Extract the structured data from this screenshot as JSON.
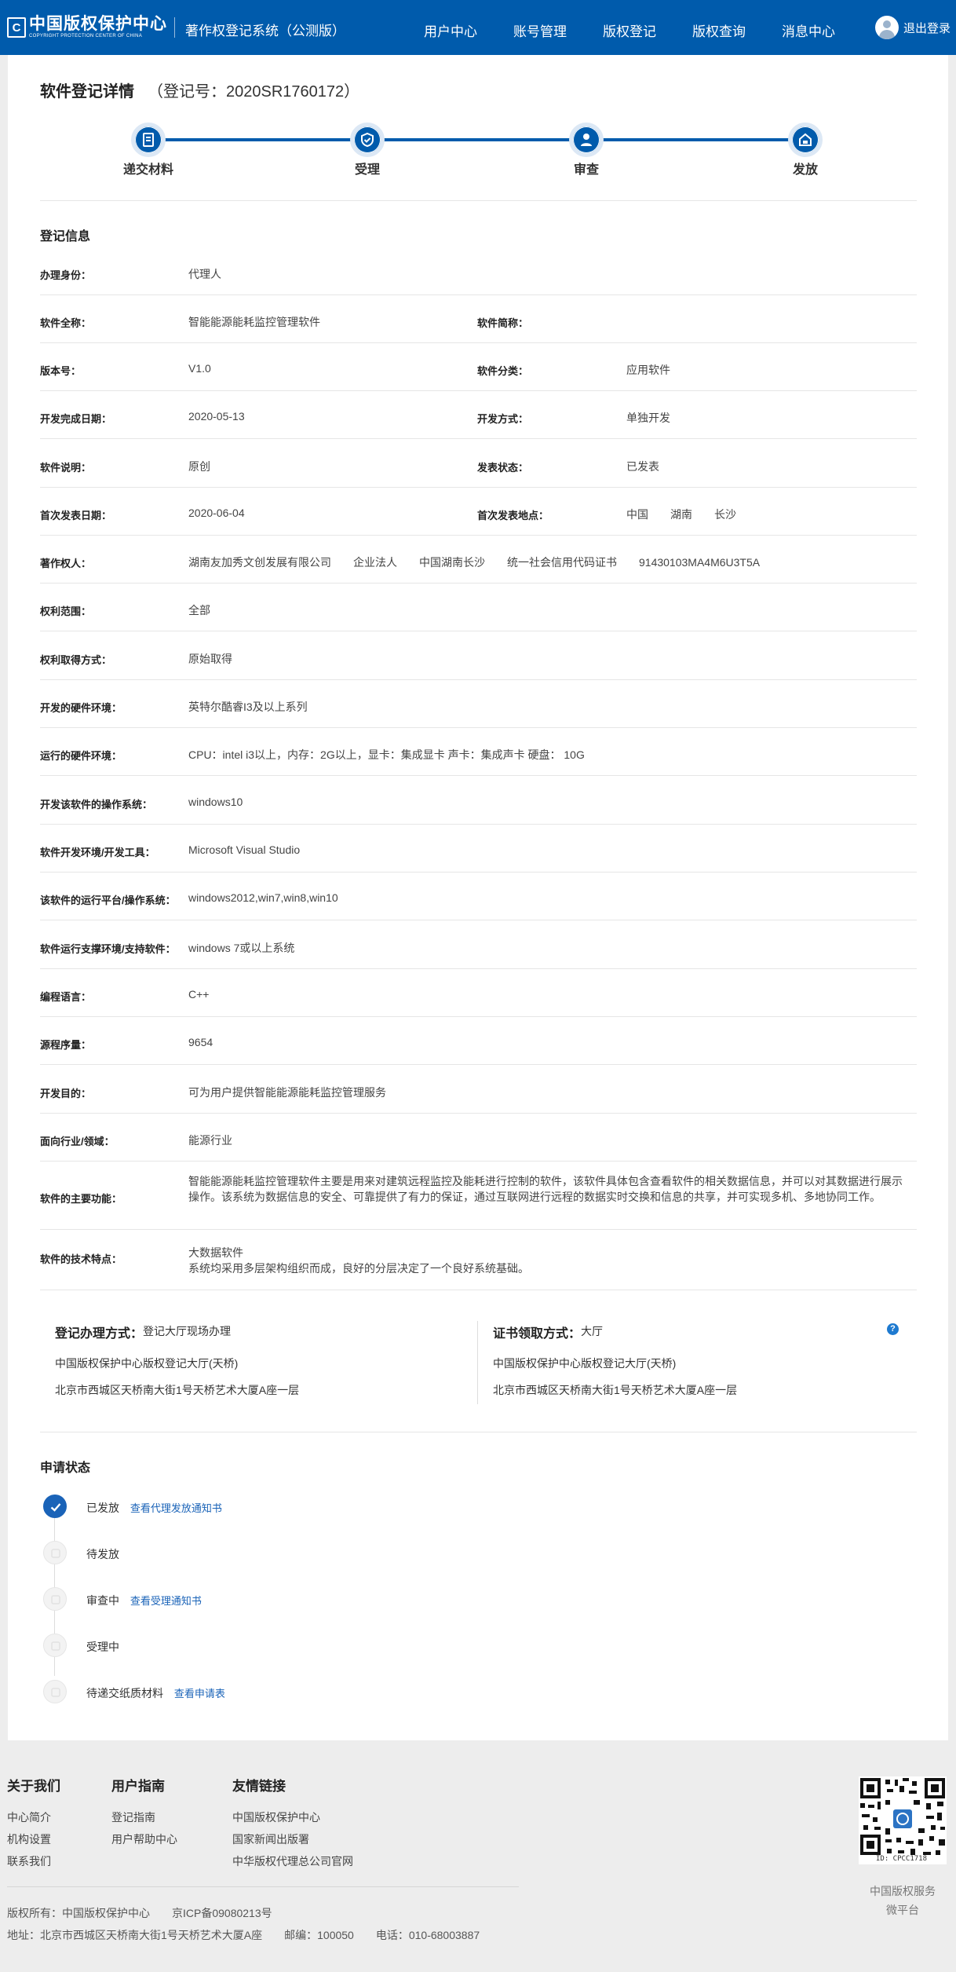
{
  "header": {
    "logo_mark": "C",
    "logo_cn": "中国版权保护中心",
    "logo_en": "COPYRIGHT PROTECTION CENTER OF CHINA",
    "system_title": "著作权登记系统（公测版）",
    "nav": [
      "用户中心",
      "账号管理",
      "版权登记",
      "版权查询",
      "消息中心"
    ],
    "logout": "退出登录",
    "accent_color": "#005bac"
  },
  "detail": {
    "title": "软件登记详情",
    "reg_no": "（登记号：2020SR1760172）"
  },
  "steps": [
    "递交材料",
    "受理",
    "审查",
    "发放"
  ],
  "info": {
    "section_title": "登记信息",
    "rows": [
      {
        "label": "办理身份：",
        "value": "代理人"
      },
      {
        "label": "软件全称：",
        "value": "智能能源能耗监控管理软件",
        "label2": "软件简称：",
        "value2": ""
      },
      {
        "label": "版本号：",
        "value": "V1.0",
        "label2": "软件分类：",
        "value2": "应用软件"
      },
      {
        "label": "开发完成日期：",
        "value": "2020-05-13",
        "label2": "开发方式：",
        "value2": "单独开发"
      },
      {
        "label": "软件说明：",
        "value": "原创",
        "label2": "发表状态：",
        "value2": "已发表"
      },
      {
        "label": "首次发表日期：",
        "value": "2020-06-04",
        "label2": "首次发表地点：",
        "value2": "中国　　湖南　　长沙"
      },
      {
        "label": "著作权人：",
        "value": "湖南友加秀文创发展有限公司　　企业法人　　中国湖南长沙　　统一社会信用代码证书　　91430103MA4M6U3T5A"
      },
      {
        "label": "权利范围：",
        "value": "全部"
      },
      {
        "label": "权利取得方式：",
        "value": "原始取得"
      },
      {
        "label": "开发的硬件环境：",
        "value": "英特尔酷睿I3及以上系列"
      },
      {
        "label": "运行的硬件环境：",
        "value": "CPU：intel i3以上，内存：2G以上，显卡：集成显卡 声卡：集成声卡 硬盘：  10G"
      },
      {
        "label": "开发该软件的操作系统：",
        "value": "windows10"
      },
      {
        "label": "软件开发环境/开发工具：",
        "value": "Microsoft Visual Studio"
      },
      {
        "label": "该软件的运行平台/操作系统：",
        "value": "windows2012,win7,win8,win10"
      },
      {
        "label": "软件运行支撑环境/支持软件：",
        "value": "windows 7或以上系统"
      },
      {
        "label": "编程语言：",
        "value": "C++"
      },
      {
        "label": "源程序量：",
        "value": "9654"
      },
      {
        "label": "开发目的：",
        "value": "可为用户提供智能能源能耗监控管理服务"
      },
      {
        "label": "面向行业/领域：",
        "value": "能源行业"
      }
    ],
    "main_function_label": "软件的主要功能：",
    "main_function_value": "智能能源能耗监控管理软件主要是用来对建筑远程监控及能耗进行控制的软件，该软件具体包含查看软件的相关数据信息，并可以对其数据进行展示操作。该系统为数据信息的安全、可靠提供了有力的保证，通过互联网进行远程的数据实时交换和信息的共享，并可实现多机、多地协同工作。",
    "tech_label": "软件的技术特点：",
    "tech_line1": "大数据软件",
    "tech_line2": "系统均采用多层架构组织而成，良好的分层决定了一个良好系统基础。"
  },
  "pickup": {
    "left_label": "登记办理方式：",
    "left_value": "登记大厅现场办理",
    "left_line1": "中国版权保护中心版权登记大厅(天桥)",
    "left_line2": "北京市西城区天桥南大街1号天桥艺术大厦A座一层",
    "right_label": "证书领取方式：",
    "right_value": "大厅",
    "right_line1": "中国版权保护中心版权登记大厅(天桥)",
    "right_line2": "北京市西城区天桥南大街1号天桥艺术大厦A座一层",
    "help": "?"
  },
  "status": {
    "section_title": "申请状态",
    "items": [
      {
        "label": "已发放",
        "link": "查看代理发放通知书"
      },
      {
        "label": "待发放",
        "link": ""
      },
      {
        "label": "审查中",
        "link": "查看受理通知书"
      },
      {
        "label": "受理中",
        "link": ""
      },
      {
        "label": "待递交纸质材料",
        "link": "查看申请表"
      }
    ]
  },
  "footer": {
    "col1_title": "关于我们",
    "col1": [
      "中心简介",
      "机构设置",
      "联系我们"
    ],
    "col2_title": "用户指南",
    "col2": [
      "登记指南",
      "用户帮助中心"
    ],
    "col3_title": "友情链接",
    "col3": [
      "中国版权保护中心",
      "国家新闻出版署",
      "中华版权代理总公司官网"
    ],
    "copyright": "版权所有：中国版权保护中心　　京ICP备09080213号",
    "address": "地址：北京市西城区天桥南大街1号天桥艺术大厦A座　　邮编：100050　　电话：010-68003887",
    "qr_id": "ID: CPCC1718",
    "qr_caption1": "中国版权服务",
    "qr_caption2": "微平台"
  }
}
